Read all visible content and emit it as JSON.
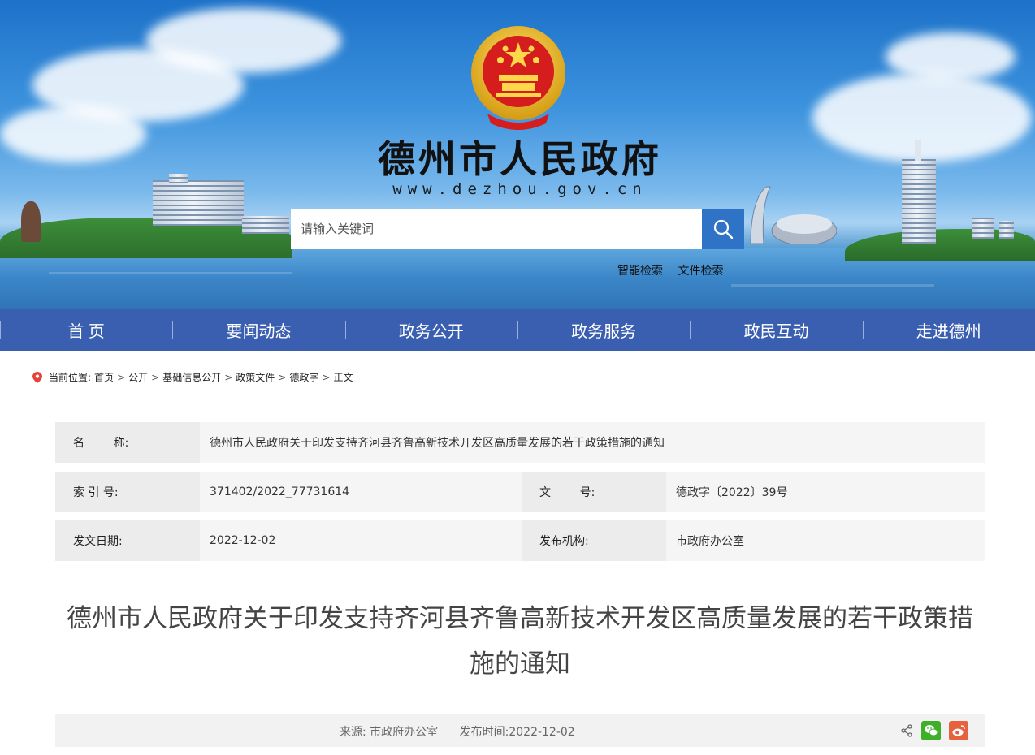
{
  "header": {
    "site_title": "德州市人民政府",
    "site_url": "www.dezhou.gov.cn",
    "search_placeholder": "请输入关键词",
    "smart_search": "智能检索",
    "file_search": "文件检索"
  },
  "nav": {
    "items": [
      {
        "label": "首 页"
      },
      {
        "label": "要闻动态"
      },
      {
        "label": "政务公开"
      },
      {
        "label": "政务服务"
      },
      {
        "label": "政民互动"
      },
      {
        "label": "走进德州"
      }
    ]
  },
  "breadcrumb": {
    "prefix": "当前位置:",
    "items": [
      "首页",
      "公开",
      "基础信息公开",
      "政策文件",
      "德政字",
      "正文"
    ]
  },
  "info": {
    "name_label": "名        称:",
    "name_value": "德州市人民政府关于印发支持齐河县齐鲁高新技术开发区高质量发展的若干政策措施的通知",
    "index_label": "索 引 号:",
    "index_value": "371402/2022_77731614",
    "docno_label": "文        号:",
    "docno_value": "德政字〔2022〕39号",
    "date_label": "发文日期:",
    "date_value": "2022-12-02",
    "org_label": "发布机构:",
    "org_value": "市政府办公室"
  },
  "article": {
    "title_line1": "德州市人民政府关于印发支持齐河县齐鲁高新技术开发区高质量发展的若干政策措",
    "title_line2": "施的通知"
  },
  "source": {
    "source_text": "来源: 市政府办公室",
    "publish_time": "发布时间:2022-12-02"
  },
  "colors": {
    "nav_bg": "#3b5fb0",
    "search_btn": "#2f73c7",
    "wechat": "#3fae29",
    "weibo": "#e6623f"
  }
}
